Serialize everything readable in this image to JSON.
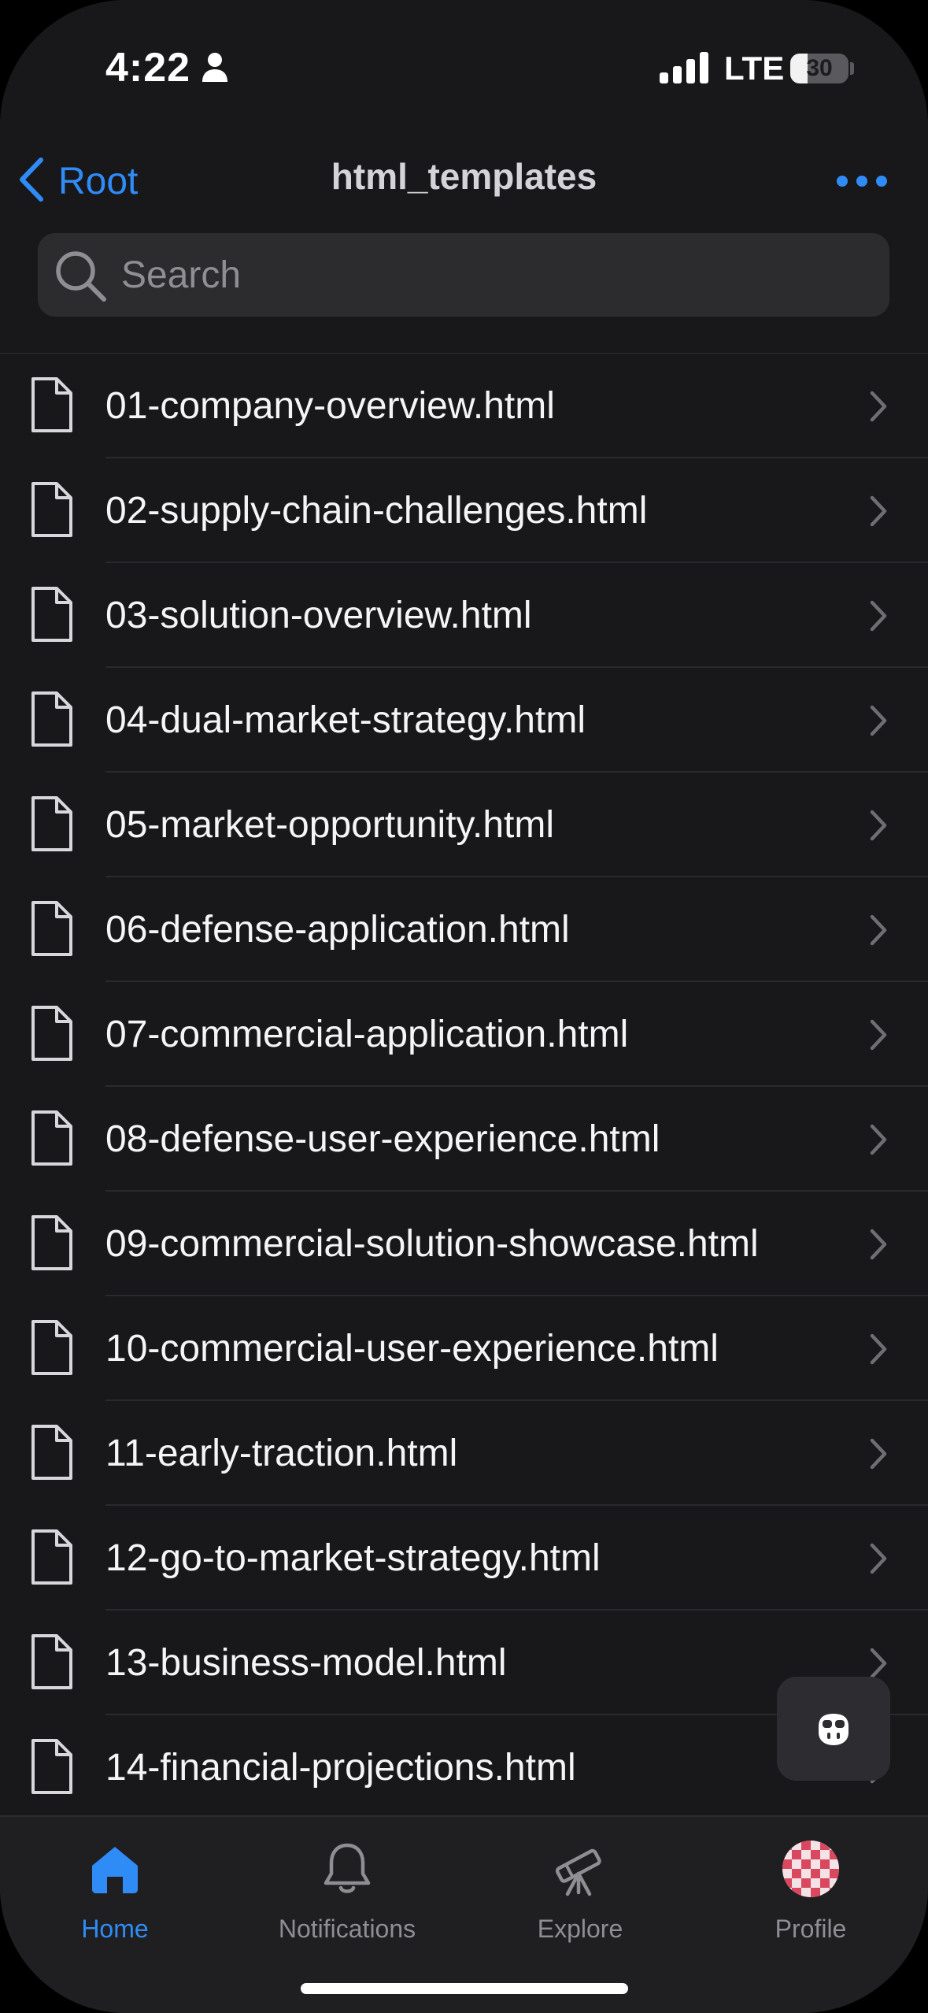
{
  "status_bar": {
    "time": "4:22",
    "network": "LTE",
    "battery": "30",
    "battery_level": 0.3
  },
  "nav": {
    "back_label": "Root",
    "title": "html_templates"
  },
  "search": {
    "placeholder": "Search",
    "value": ""
  },
  "files": [
    {
      "name": "01-company-overview.html"
    },
    {
      "name": "02-supply-chain-challenges.html"
    },
    {
      "name": "03-solution-overview.html"
    },
    {
      "name": "04-dual-market-strategy.html"
    },
    {
      "name": "05-market-opportunity.html"
    },
    {
      "name": "06-defense-application.html"
    },
    {
      "name": "07-commercial-application.html"
    },
    {
      "name": "08-defense-user-experience.html"
    },
    {
      "name": "09-commercial-solution-showcase.html"
    },
    {
      "name": "10-commercial-user-experience.html"
    },
    {
      "name": "11-early-traction.html"
    },
    {
      "name": "12-go-to-market-strategy.html"
    },
    {
      "name": "13-business-model.html"
    },
    {
      "name": "14-financial-projections.html"
    }
  ],
  "tabs": [
    {
      "label": "Home",
      "icon": "home-icon",
      "active": true
    },
    {
      "label": "Notifications",
      "icon": "bell-icon",
      "active": false
    },
    {
      "label": "Explore",
      "icon": "telescope-icon",
      "active": false
    },
    {
      "label": "Profile",
      "icon": "avatar",
      "active": false
    }
  ],
  "colors": {
    "accent": "#2f8cf7",
    "background": "#18181b",
    "tab_inactive": "#8e8e93"
  }
}
